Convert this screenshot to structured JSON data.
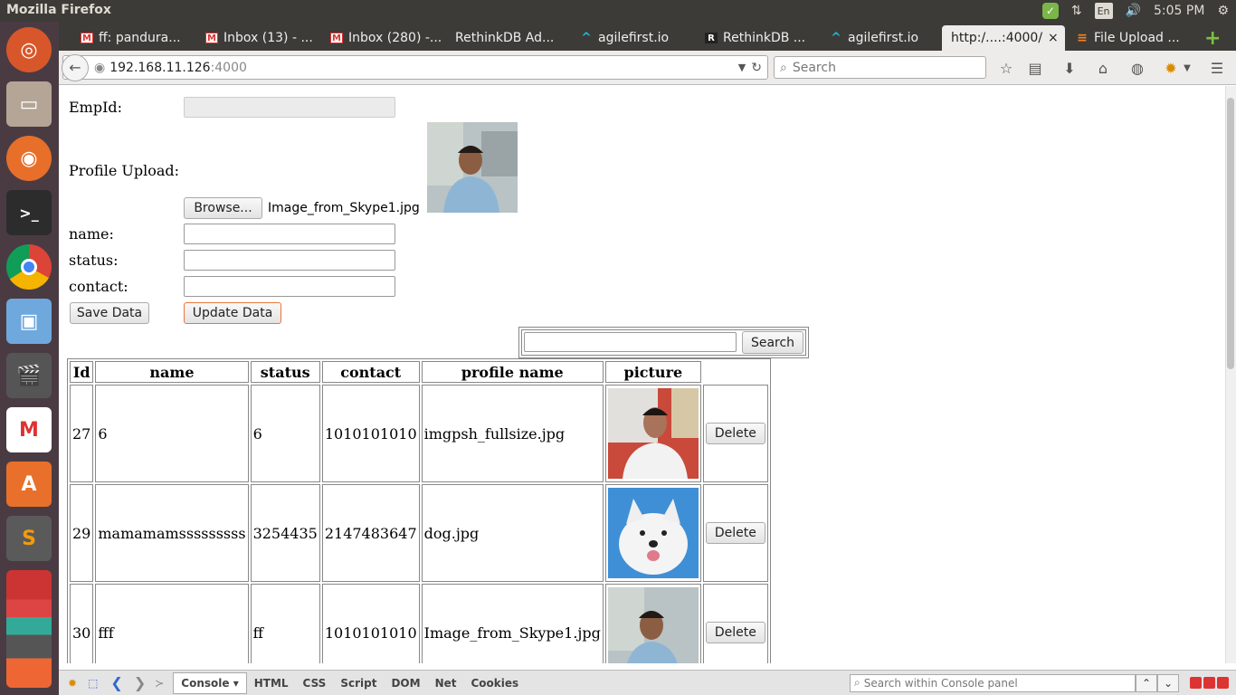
{
  "system": {
    "window_title": "Mozilla Firefox",
    "clock": "5:05 PM",
    "keyboard_layout": "En"
  },
  "launcher": {
    "items": [
      "ubuntu-icon",
      "files-icon",
      "firefox-icon",
      "terminal-icon",
      "chrome-icon",
      "virtualbox-icon",
      "video-editor-icon",
      "gmail-icon",
      "software-center-icon",
      "sublime-icon",
      "apps-stack-icon"
    ]
  },
  "tabs": [
    {
      "label": "ff: pandura...",
      "icon": "gmail-icon"
    },
    {
      "label": "Inbox (13) - ...",
      "icon": "gmail-icon"
    },
    {
      "label": "Inbox (280) -...",
      "icon": "gmail-icon"
    },
    {
      "label": "RethinkDB Ad...",
      "icon": "none"
    },
    {
      "label": "agilefirst.io",
      "icon": "agile-icon"
    },
    {
      "label": "RethinkDB ...",
      "icon": "r-icon"
    },
    {
      "label": "agilefirst.io",
      "icon": "agile-icon"
    },
    {
      "label": "http:/....:4000/",
      "icon": "none",
      "active": true,
      "close": "×"
    },
    {
      "label": "File Upload ...",
      "icon": "stackoverflow-icon"
    }
  ],
  "new_tab": "+",
  "address": {
    "host": "192.168.11.126",
    "port": ":4000"
  },
  "search": {
    "placeholder": "Search"
  },
  "form": {
    "empid_label": "EmpId:",
    "profile_label": "Profile Upload:",
    "browse_label": "Browse...",
    "file_name": "Image_from_Skype1.jpg",
    "name_label": "name:",
    "status_label": "status:",
    "contact_label": "contact:",
    "save_label": "Save Data",
    "update_label": "Update Data"
  },
  "table_search": {
    "button": "Search"
  },
  "table": {
    "headers": [
      "Id",
      "name",
      "status",
      "contact",
      "profile name",
      "picture"
    ],
    "delete_label": "Delete",
    "rows": [
      {
        "id": "27",
        "name": "6",
        "status": "6",
        "contact": "1010101010",
        "profile": "imgpsh_fullsize.jpg",
        "picture": "man-photo"
      },
      {
        "id": "29",
        "name": "mamamamsssssssss",
        "status": "3254435",
        "contact": "2147483647",
        "profile": "dog.jpg",
        "picture": "dog-photo"
      },
      {
        "id": "30",
        "name": "fff",
        "status": "ff",
        "contact": "1010101010",
        "profile": "Image_from_Skype1.jpg",
        "picture": "man-photo"
      }
    ]
  },
  "firebug": {
    "tabs": [
      "Console",
      "HTML",
      "CSS",
      "Script",
      "DOM",
      "Net",
      "Cookies"
    ],
    "search_placeholder": "Search within Console panel"
  }
}
